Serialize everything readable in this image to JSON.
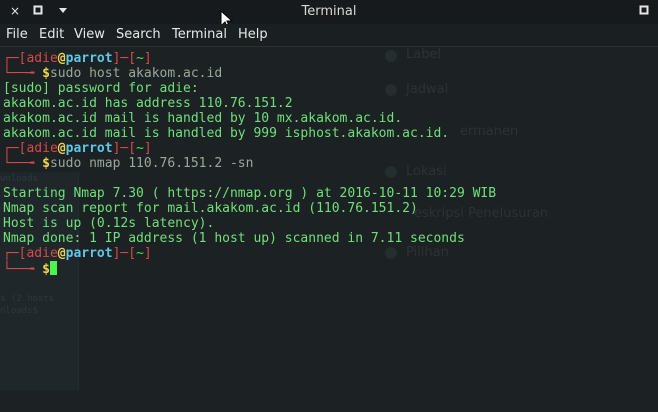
{
  "window": {
    "title": "Terminal",
    "close_glyph": "×",
    "restore_glyph": "▪",
    "min_glyph": "▾"
  },
  "menu": [
    "File",
    "Edit",
    "View",
    "Search",
    "Terminal",
    "Help"
  ],
  "ghost": {
    "label": "Label",
    "jadwal": "Jadwal",
    "permanen": "ermanen",
    "lokasi": "Lokasi",
    "deskripsi": "eskripsi Penelusuran",
    "pilihan": "Pilihan",
    "small1": "wnloads",
    "small2": "s (2 hosts",
    "small3": "nloads$"
  },
  "prompt": {
    "open": "┌─[",
    "user": "adie",
    "at": "@",
    "host": "parrot",
    "mid": "]─[",
    "dir": "~",
    "close": "]",
    "arrow": "└──╼ ",
    "dollar": "$"
  },
  "lines": {
    "cmd1": "sudo host akakom.ac.id",
    "out1": "[sudo] password for adie:",
    "out2": "akakom.ac.id has address 110.76.151.2",
    "out3": "akakom.ac.id mail is handled by 10 mx.akakom.ac.id.",
    "out4": "akakom.ac.id mail is handled by 999 isphost.akakom.ac.id.",
    "cmd2": "sudo nmap 110.76.151.2 -sn",
    "nm1": "Starting Nmap 7.30 ( https://nmap.org ) at 2016-10-11 10:29 WIB",
    "nm2": "Nmap scan report for mail.akakom.ac.id (110.76.151.2)",
    "nm3": "Host is up (0.12s latency).",
    "nm4": "Nmap done: 1 IP address (1 host up) scanned in 7.11 seconds"
  }
}
